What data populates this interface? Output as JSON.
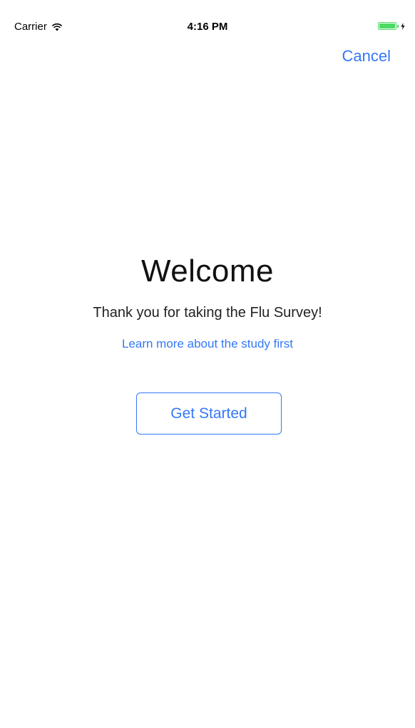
{
  "status_bar": {
    "carrier": "Carrier",
    "time": "4:16 PM",
    "battery_color": "#4cd964",
    "battery_level": 1.0
  },
  "nav": {
    "cancel_label": "Cancel"
  },
  "welcome": {
    "title": "Welcome",
    "subtitle": "Thank you for taking the Flu Survey!",
    "learn_more_label": "Learn more about the study first",
    "get_started_label": "Get Started"
  },
  "colors": {
    "accent": "#3478f6",
    "background": "#ffffff",
    "text": "#111111"
  }
}
